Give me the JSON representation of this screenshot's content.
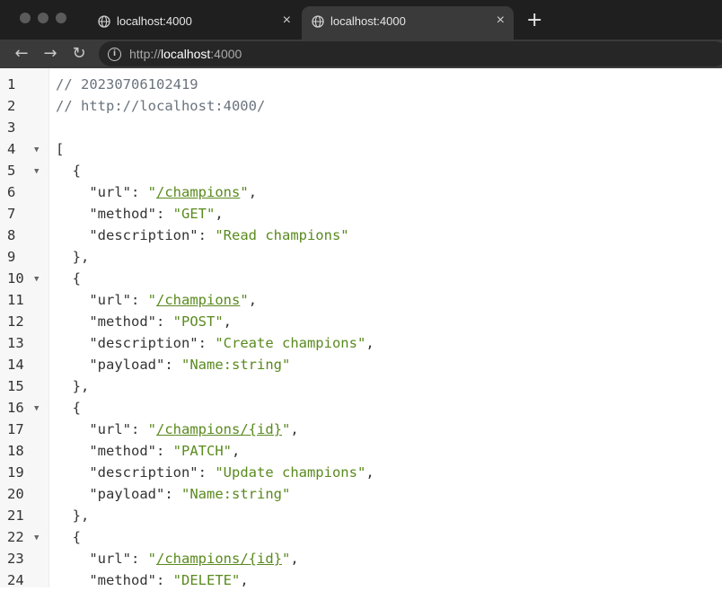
{
  "tabs": [
    {
      "title": "localhost:4000",
      "close": "×"
    },
    {
      "title": "localhost:4000",
      "close": "×"
    }
  ],
  "new_tab": "+",
  "nav": {
    "back": "←",
    "forward": "→",
    "reload": "↻"
  },
  "address": {
    "scheme": "http://",
    "host": "localhost",
    "port": ":4000"
  },
  "lines": [
    {
      "n": "1",
      "c": "// 20230706102419"
    },
    {
      "n": "2",
      "c": "// http://localhost:4000/"
    },
    {
      "n": "3",
      "c": ""
    },
    {
      "n": "4",
      "c": "["
    },
    {
      "n": "5",
      "c": "{"
    },
    {
      "n": "6",
      "k": "url",
      "v": "/champions"
    },
    {
      "n": "7",
      "k": "method",
      "v": "GET"
    },
    {
      "n": "8",
      "k": "description",
      "v": "Read champions"
    },
    {
      "n": "9",
      "c": "},"
    },
    {
      "n": "10",
      "c": "{"
    },
    {
      "n": "11",
      "k": "url",
      "v": "/champions"
    },
    {
      "n": "12",
      "k": "method",
      "v": "POST"
    },
    {
      "n": "13",
      "k": "description",
      "v": "Create champions"
    },
    {
      "n": "14",
      "k": "payload",
      "v": "Name:string"
    },
    {
      "n": "15",
      "c": "},"
    },
    {
      "n": "16",
      "c": "{"
    },
    {
      "n": "17",
      "k": "url",
      "v": "/champions/{id}"
    },
    {
      "n": "18",
      "k": "method",
      "v": "PATCH"
    },
    {
      "n": "19",
      "k": "description",
      "v": "Update champions"
    },
    {
      "n": "20",
      "k": "payload",
      "v": "Name:string"
    },
    {
      "n": "21",
      "c": "},"
    },
    {
      "n": "22",
      "c": "{"
    },
    {
      "n": "23",
      "k": "url",
      "v": "/champions/{id}"
    },
    {
      "n": "24",
      "k": "method",
      "v": "DELETE"
    }
  ]
}
